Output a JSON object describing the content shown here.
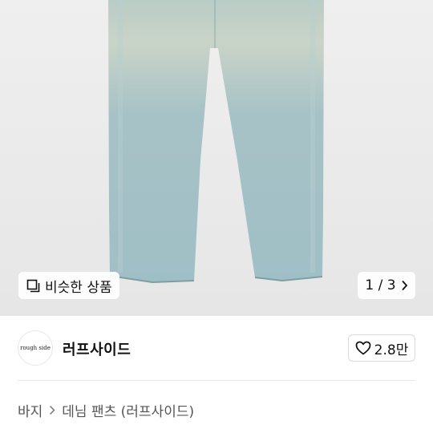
{
  "hero": {
    "similar_label": "비슷한 상품",
    "counter": "1 / 3"
  },
  "shop": {
    "logo_text": "rough side",
    "name": "러프사이드",
    "like_count": "2.8만"
  },
  "breadcrumb": {
    "level1": "바지",
    "level2": "데님 팬츠 (러프사이드)"
  },
  "colors": {
    "hero_bg": "#ebebeb",
    "denim": "#a9c3c4"
  }
}
